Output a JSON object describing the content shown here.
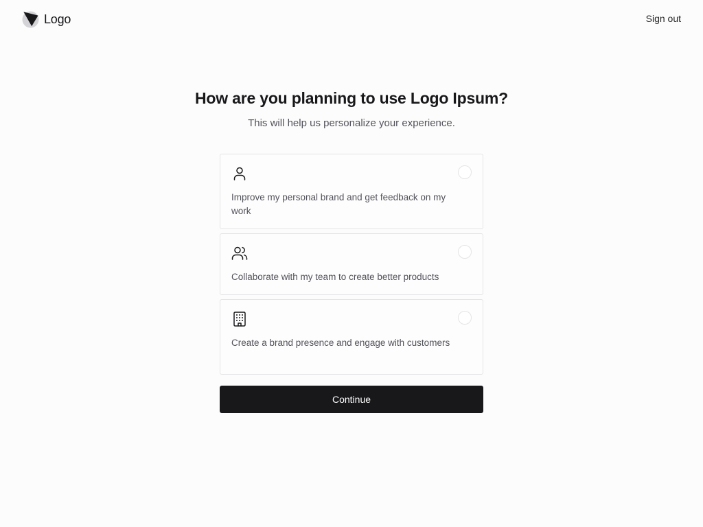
{
  "header": {
    "logo_text": "Logo",
    "sign_out_label": "Sign out"
  },
  "main": {
    "title": "How are you planning to use Logo Ipsum?",
    "subtitle": "This will help us personalize your experience.",
    "options": [
      {
        "icon": "user-icon",
        "label": "Improve my personal brand and get feedback on my work",
        "selected": false
      },
      {
        "icon": "users-icon",
        "label": "Collaborate with my team to create better products",
        "selected": false
      },
      {
        "icon": "building-icon",
        "label": "Create a brand presence and engage with customers",
        "selected": false
      }
    ],
    "continue_label": "Continue"
  },
  "colors": {
    "background": "#fcfcfc",
    "primary_button": "#18181b",
    "border": "#e4e4e7",
    "muted_text": "#52525b"
  }
}
